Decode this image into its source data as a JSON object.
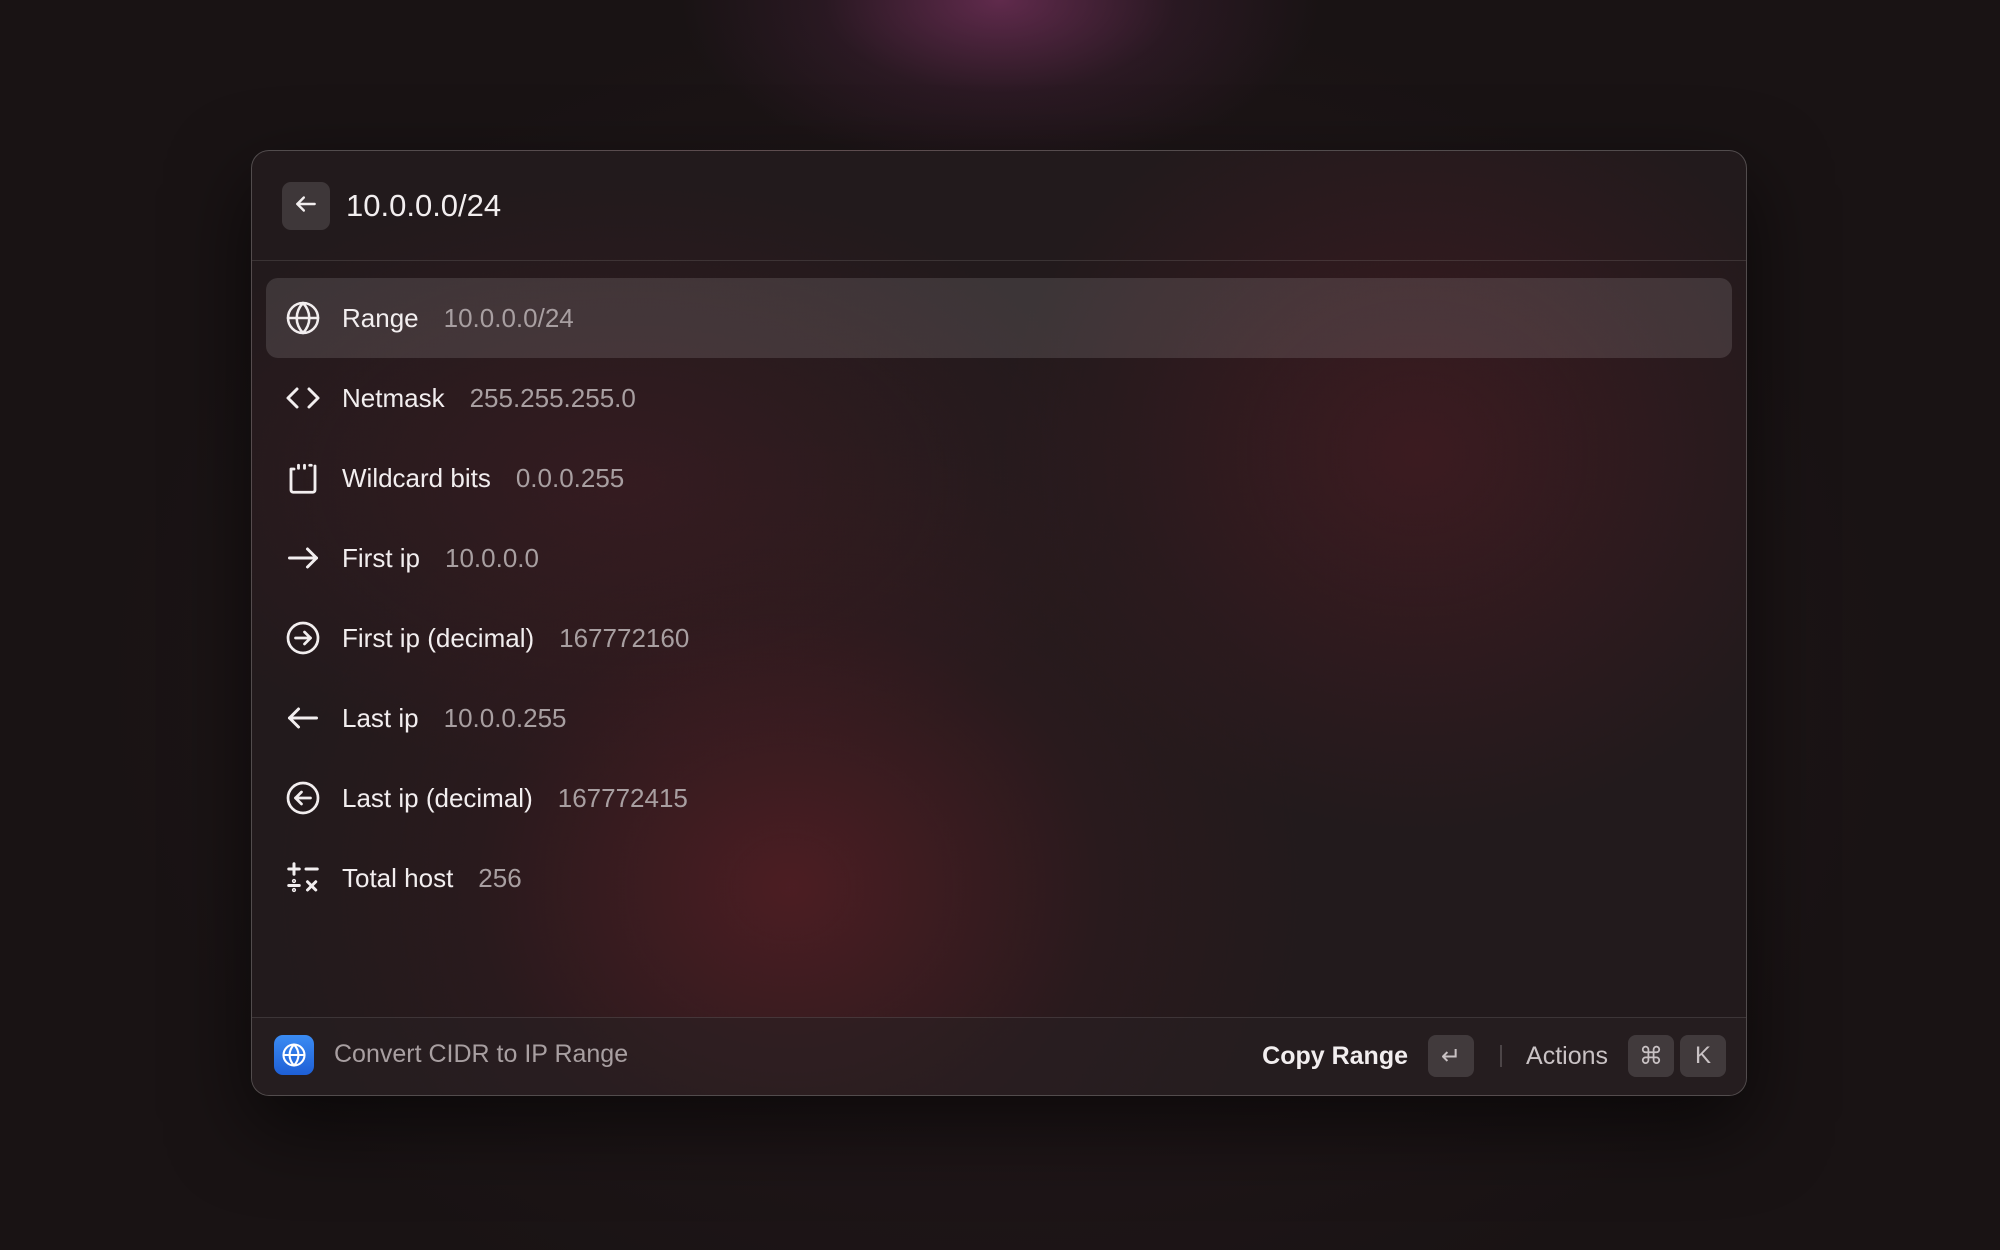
{
  "search": {
    "value": "10.0.0.0/24"
  },
  "items": [
    {
      "title": "Range",
      "value": "10.0.0.0/24",
      "icon": "globe-icon",
      "selected": true
    },
    {
      "title": "Netmask",
      "value": "255.255.255.0",
      "icon": "code-brackets-icon"
    },
    {
      "title": "Wildcard bits",
      "value": "0.0.0.255",
      "icon": "wildcard-frame-icon"
    },
    {
      "title": "First ip",
      "value": "10.0.0.0",
      "icon": "arrow-right-icon"
    },
    {
      "title": "First ip (decimal)",
      "value": "167772160",
      "icon": "circle-arrow-right-icon"
    },
    {
      "title": "Last ip",
      "value": "10.0.0.255",
      "icon": "arrow-left-icon"
    },
    {
      "title": "Last ip (decimal)",
      "value": "167772415",
      "icon": "circle-arrow-left-icon"
    },
    {
      "title": "Total host",
      "value": "256",
      "icon": "calculator-operators-icon"
    }
  ],
  "footer": {
    "extension_name": "Convert CIDR to IP Range",
    "primary_action": "Copy Range",
    "primary_key": "↵",
    "actions_label": "Actions",
    "actions_keys": [
      "⌘",
      "K"
    ]
  },
  "colors": {
    "accent_icon": "#2f7cf0",
    "text_primary": "#f2eeef",
    "text_secondary": "#a89fa1"
  }
}
